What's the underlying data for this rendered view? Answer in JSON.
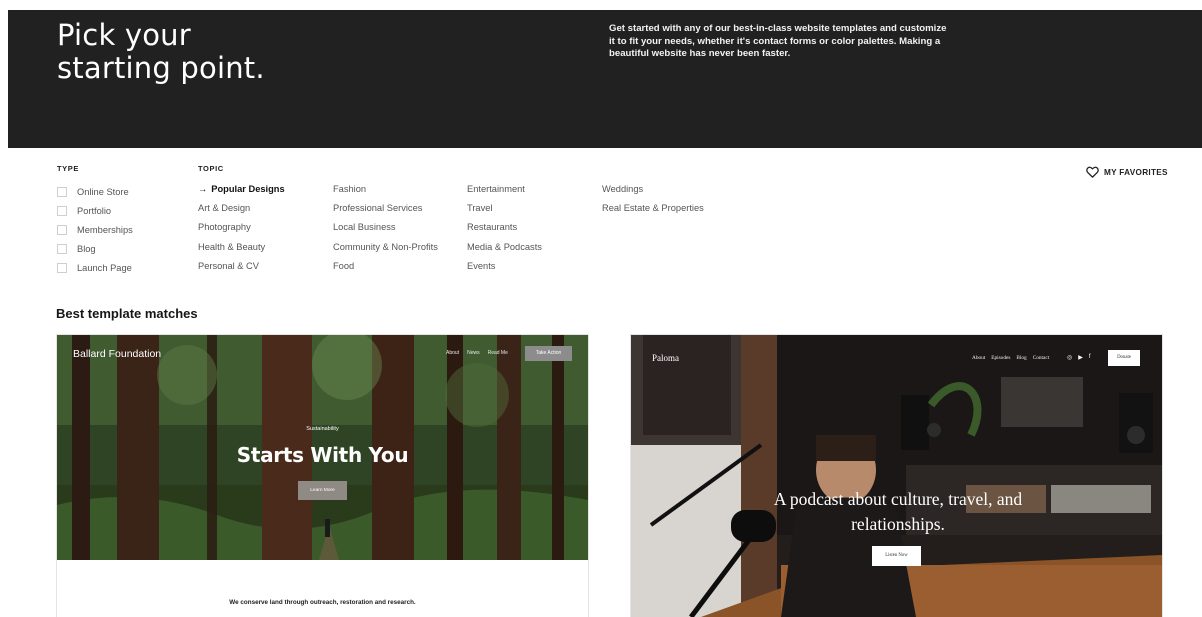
{
  "hero": {
    "title_line1": "Pick your",
    "title_line2": "starting point.",
    "description": "Get started with any of our best-in-class website templates and customize it to fit your needs, whether it's contact forms or color palettes. Making a beautiful website has never been faster."
  },
  "filters": {
    "type_heading": "TYPE",
    "topic_heading": "TOPIC",
    "types": [
      "Online Store",
      "Portfolio",
      "Memberships",
      "Blog",
      "Launch Page"
    ],
    "topics": {
      "col1": [
        "Popular Designs",
        "Art & Design",
        "Photography",
        "Health & Beauty",
        "Personal & CV"
      ],
      "col2": [
        "Fashion",
        "Professional Services",
        "Local Business",
        "Community & Non-Profits",
        "Food"
      ],
      "col3": [
        "Entertainment",
        "Travel",
        "Restaurants",
        "Media & Podcasts",
        "Events"
      ],
      "col4": [
        "Weddings",
        "Real Estate & Properties"
      ]
    },
    "active_topic": "Popular Designs",
    "active_arrow": "→"
  },
  "favorites": {
    "label": "MY FAVORITES",
    "icon": "heart-icon"
  },
  "section_title": "Best template matches",
  "templates": [
    {
      "name": "Ballard Foundation",
      "nav": [
        "About",
        "News",
        "Read Me"
      ],
      "cta": "Take Action",
      "eyebrow": "Sustainability",
      "heading": "Starts With You",
      "button": "Learn More",
      "mission": "We conserve land through outreach, restoration and research."
    },
    {
      "name": "Paloma",
      "nav": [
        "About",
        "Episodes",
        "Blog",
        "Contact"
      ],
      "social": [
        "◎",
        "▶",
        "f"
      ],
      "cta": "Donate",
      "heading": "A podcast about culture, travel, and relationships.",
      "button": "Listen Now"
    }
  ],
  "colors": {
    "hero_bg": "#212121",
    "page_bg": "#ffffff",
    "text": "#1b1b1b"
  }
}
